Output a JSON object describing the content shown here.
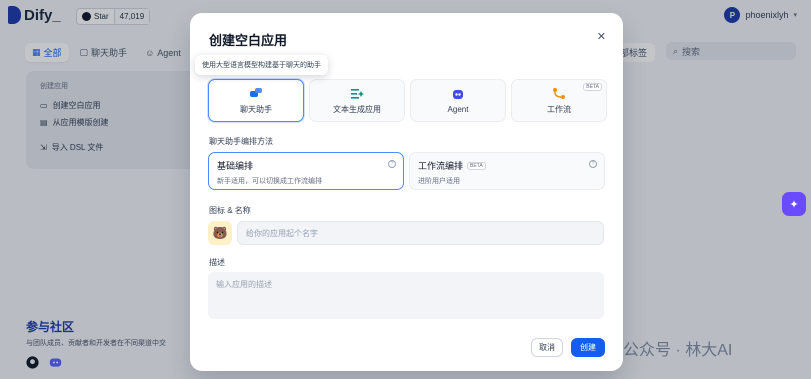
{
  "app": {
    "brand": "Dify_",
    "github_star_label": "Star",
    "github_star_count": "47,019",
    "username": "phoenixlyh",
    "avatar_initial": "P"
  },
  "nav": {
    "tabs": [
      {
        "label": "全部",
        "icon": "grid-icon",
        "active": true
      },
      {
        "label": "聊天助手",
        "icon": "chat-icon",
        "active": false
      },
      {
        "label": "Agent",
        "icon": "agent-icon",
        "active": false
      }
    ],
    "tag_filter": "部标签",
    "search_placeholder": "搜索"
  },
  "create_card": {
    "section_label": "创建应用",
    "items": [
      "创建空白应用",
      "从应用模版创建",
      "导入 DSL 文件"
    ]
  },
  "community": {
    "title": "参与社区",
    "desc": "与团队成员、贡献者和开发者在不同渠道中交"
  },
  "watermark": "公众号 · 林大AI",
  "modal": {
    "title": "创建空白应用",
    "tooltip": "使用大型语言模型构建基于聊天的助手",
    "app_types": [
      {
        "label": "聊天助手",
        "icon": "chat-bot-icon",
        "selected": true,
        "beta": false
      },
      {
        "label": "文本生成应用",
        "icon": "text-gen-icon",
        "selected": false,
        "beta": false
      },
      {
        "label": "Agent",
        "icon": "agent-robot-icon",
        "selected": false,
        "beta": false
      },
      {
        "label": "工作流",
        "icon": "workflow-icon",
        "selected": false,
        "beta": true
      }
    ],
    "beta_label": "BETA",
    "orchestration_label": "聊天助手编排方法",
    "modes": [
      {
        "name": "基础编排",
        "desc": "新手适用，可以切换成工作流编排",
        "selected": true,
        "beta": false
      },
      {
        "name": "工作流编排",
        "desc": "进阶用户适用",
        "selected": false,
        "beta": true
      }
    ],
    "icon_name_label": "图标 & 名称",
    "name_placeholder": "给你的应用起个名字",
    "description_label": "描述",
    "description_placeholder": "输入应用的描述",
    "cancel_label": "取消",
    "create_label": "创建",
    "app_icon_emoji": "🐻"
  },
  "colors": {
    "primary": "#155eef",
    "brand_dark": "#1c3aa9",
    "float_button": "#6a4bff"
  }
}
